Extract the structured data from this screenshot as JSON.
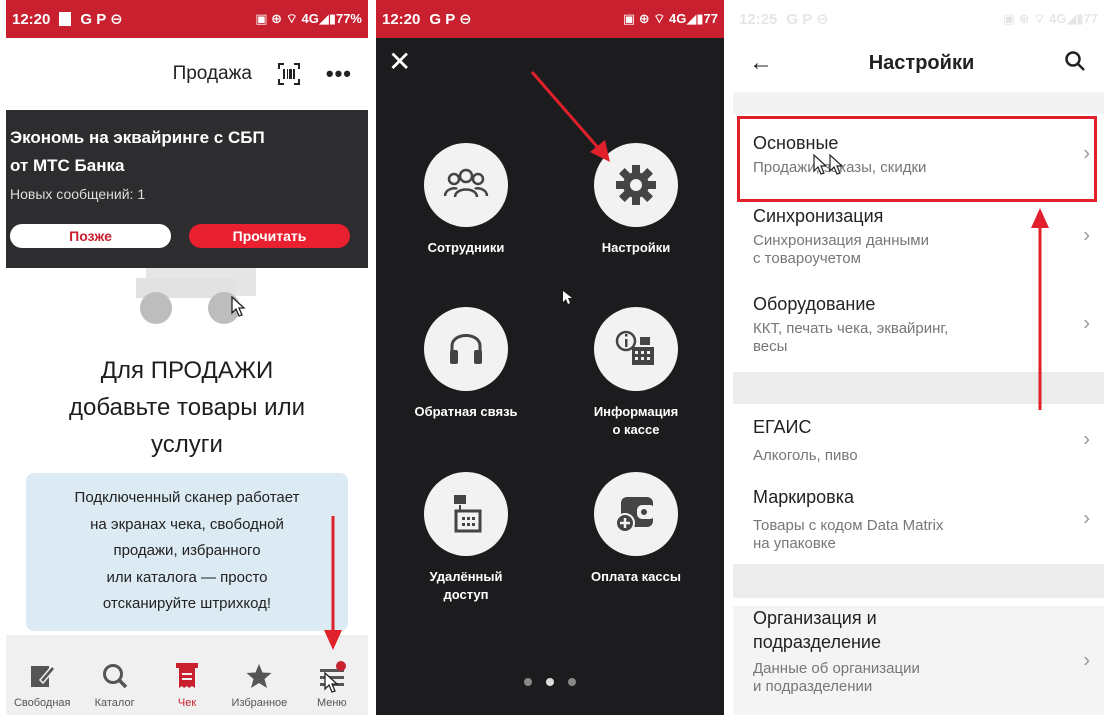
{
  "status": {
    "p1_time": "12:20",
    "p1_left": "G P ⊖",
    "p1_right": "▣ ⊕ ⌔ 4G◢▮77%",
    "p2_time": "12:20",
    "p2_left": "G P ⊖",
    "p2_right": "▣ ⊕ ⌔ 4G◢▮77",
    "p3_time": "12:25",
    "p3_left": "G P ⊖",
    "p3_right": "▣ ⊕ ⌔ 4G◢▮77"
  },
  "sale": {
    "title": "Продажа",
    "barcode_icon": "barcode-icon",
    "more_icon": "more-icon",
    "more": "•••",
    "promo": {
      "headline_1": "Экономь на эквайринге с СБП",
      "headline_2": "от МТС Банка",
      "messages": "Новых сообщений: 1",
      "later": "Позже",
      "read": "Прочитать"
    },
    "empty_1": "Для ПРОДАЖИ",
    "empty_2": "добавьте товары или",
    "empty_3": "услуги",
    "hint_lines": [
      "Подключенный сканер работает",
      "на экранах чека, свободной",
      "продажи, избранного",
      "или каталога — просто",
      "отсканируйте штрихкод!"
    ],
    "tabs": [
      {
        "label": "Свободная",
        "icon": "edit-icon"
      },
      {
        "label": "Каталог",
        "icon": "search-icon"
      },
      {
        "label": "Чек",
        "icon": "receipt-icon"
      },
      {
        "label": "Избранное",
        "icon": "star-icon"
      },
      {
        "label": "Меню",
        "icon": "menu-icon"
      }
    ]
  },
  "menu": {
    "close": "✕",
    "items": [
      {
        "label_1": "Сотрудники",
        "label_2": "",
        "icon": "people-icon"
      },
      {
        "label_1": "Настройки",
        "label_2": "",
        "icon": "gear-icon"
      },
      {
        "label_1": "Обратная связь",
        "label_2": "",
        "icon": "headset-icon"
      },
      {
        "label_1": "Информация",
        "label_2": "о кассе",
        "icon": "cash-register-info-icon"
      },
      {
        "label_1": "Удалённый",
        "label_2": "доступ",
        "icon": "remote-access-icon"
      },
      {
        "label_1": "Оплата кассы",
        "label_2": "",
        "icon": "wallet-icon"
      }
    ],
    "pages": 3,
    "current_page": 2
  },
  "settings": {
    "title": "Настройки",
    "back": "←",
    "rows": [
      {
        "title": "Основные",
        "sub_1": "Продажи, заказы, скидки",
        "sub_2": ""
      },
      {
        "title": "Синхронизация",
        "sub_1": "Синхронизация данными",
        "sub_2": "с товароучетом"
      },
      {
        "title": "Оборудование",
        "sub_1": "ККТ, печать чека, эквайринг,",
        "sub_2": "весы"
      },
      {
        "title": "ЕГАИС",
        "sub_1": "Алкоголь, пиво",
        "sub_2": ""
      },
      {
        "title": "Маркировка",
        "sub_1": "Товары с кодом Data Matrix",
        "sub_2": "на упаковке"
      },
      {
        "title": "Организация и",
        "title_2": "подразделение",
        "sub_1": "Данные об организации",
        "sub_2": "и подразделении"
      }
    ],
    "chevron": "›"
  },
  "colors": {
    "brand_red": "#c8202f",
    "annotation_red": "#e0202a",
    "menu_bg": "#1c1c1e"
  }
}
